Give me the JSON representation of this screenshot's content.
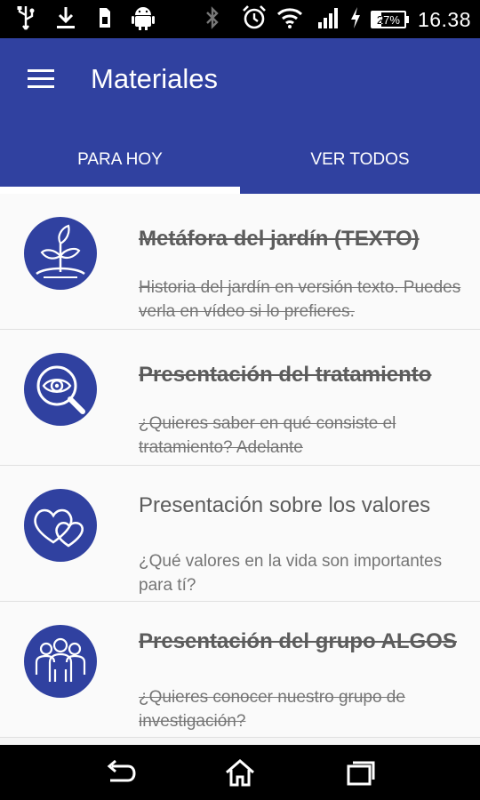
{
  "status_bar": {
    "time": "16.38",
    "battery_percent": "27%",
    "battery_level": 0.27,
    "left_icons": [
      "usb-icon",
      "download-icon",
      "sim-card-icon",
      "android-icon"
    ],
    "right_icons": [
      "bluetooth-icon",
      "alarm-icon",
      "wifi-icon",
      "signal-icon",
      "charging-icon",
      "battery-icon"
    ]
  },
  "app_bar": {
    "title": "Materiales",
    "menu_icon": "hamburger-menu-icon",
    "background_color": "#3041a0"
  },
  "tabs": [
    {
      "label": "PARA HOY",
      "selected": true
    },
    {
      "label": "VER TODOS",
      "selected": false
    }
  ],
  "items": [
    {
      "title": "Metáfora del jardín (TEXTO)",
      "description": "Historia del jardín en versión texto. Puedes verla en vídeo si lo prefieres.",
      "icon": "plant-sprout-icon",
      "completed": true
    },
    {
      "title": "Presentación del tratamiento",
      "description": "¿Quieres saber en qué consiste el tratamiento? Adelante",
      "icon": "eye-magnifier-icon",
      "completed": true
    },
    {
      "title": "Presentación sobre los valores",
      "description": "¿Qué valores en la vida son importantes para tí?",
      "icon": "two-hearts-icon",
      "completed": false
    },
    {
      "title": "Presentación del grupo ALGOS",
      "description": "¿Quieres conocer nuestro grupo de investigación?",
      "icon": "group-people-icon",
      "completed": true
    }
  ],
  "nav_bar": {
    "buttons": [
      "back-icon",
      "home-icon",
      "recents-icon"
    ]
  }
}
